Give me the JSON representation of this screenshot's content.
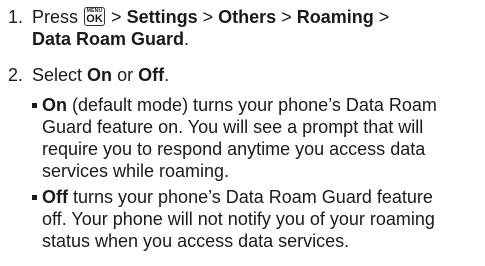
{
  "steps": [
    {
      "number": "1.",
      "prefix": "Press",
      "key_top": "MENU",
      "key_main": "OK",
      "path_sep": ">",
      "path": [
        "Settings",
        "Others",
        "Roaming",
        "Data Roam Guard"
      ],
      "end": "."
    },
    {
      "number": "2.",
      "text_select": "Select",
      "on": "On",
      "or": "or",
      "off": "Off",
      "end": "."
    }
  ],
  "bullets": [
    {
      "label": "On",
      "line1_rest": " (default mode) turns your phone’s Data Roam",
      "lines": [
        "Guard feature on. You will see a prompt that will",
        "require you to respond anytime you access data",
        "services while roaming."
      ]
    },
    {
      "label": "Off",
      "line1_rest": " turns your phone’s Data Roam Guard feature",
      "lines": [
        "off. Your phone will not notify you of your roaming",
        "status when you access data services."
      ]
    }
  ]
}
